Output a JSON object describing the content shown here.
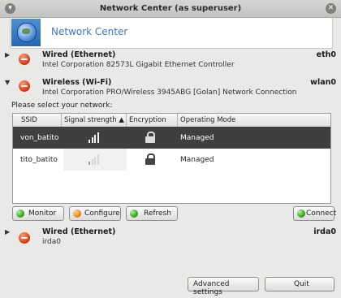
{
  "window": {
    "title": "Network Center (as superuser)"
  },
  "banner": {
    "title": "Network Center"
  },
  "connections": [
    {
      "name": "Wired (Ethernet)",
      "device": "Intel Corporation 82573L Gigabit Ethernet Controller",
      "interface": "eth0",
      "expanded": false
    },
    {
      "name": "Wireless (Wi-Fi)",
      "device": "Intel Corporation PRO/Wireless 3945ABG [Golan] Network Connection",
      "interface": "wlan0",
      "expanded": true
    },
    {
      "name": "Wired (Ethernet)",
      "device": "irda0",
      "interface": "irda0",
      "expanded": false
    }
  ],
  "wireless": {
    "select_label": "Please select your network:",
    "columns": [
      "SSID",
      "Signal strength ▲",
      "Encryption",
      "Operating Mode"
    ],
    "networks": [
      {
        "ssid": "von_batito",
        "signal": 0.9,
        "encrypted": true,
        "mode": "Managed",
        "selected": true
      },
      {
        "ssid": "tito_batito",
        "signal": 0.25,
        "encrypted": true,
        "mode": "Managed",
        "selected": false
      }
    ],
    "buttons": {
      "monitor": "Monitor",
      "configure": "Configure",
      "refresh": "Refresh",
      "connect": "Connect"
    }
  },
  "footer": {
    "advanced_settings": "Advanced settings",
    "quit": "Quit"
  },
  "icons": {
    "status": "disconnected-status-icon",
    "banner": "globe-icon"
  },
  "colors": {
    "accent": "#3a76c4",
    "selected_row": "#3f3f3f",
    "status_red": "#e2401a",
    "button_green": "#3aa620",
    "button_orange": "#f0891a"
  }
}
